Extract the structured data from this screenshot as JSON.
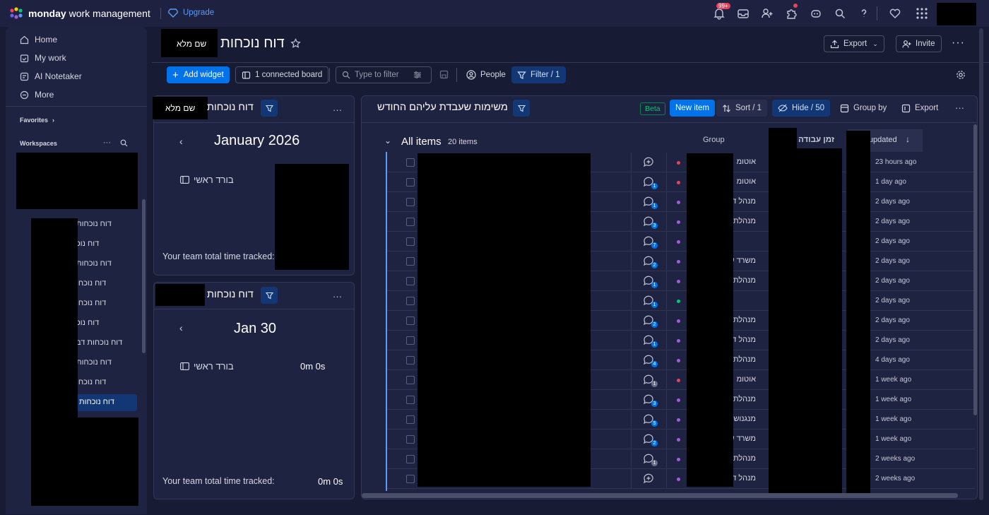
{
  "topbar": {
    "brand": "monday",
    "product": "work management",
    "upgrade": "Upgrade",
    "notif_count": "99+"
  },
  "sidebar": {
    "nav": [
      {
        "label": "Home",
        "icon": "home-icon"
      },
      {
        "label": "My work",
        "icon": "calendar-check-icon"
      },
      {
        "label": "AI Notetaker",
        "icon": "notetaker-icon"
      },
      {
        "label": "More",
        "icon": "more-circle-icon"
      }
    ],
    "favorites": "Favorites",
    "workspaces": "Workspaces",
    "boards": [
      "דוח נוכחות",
      "דוח נוכ",
      "דוח נוכחות",
      "דוח נוכחו",
      "דוח נוכחו",
      "דוח נוכ",
      "דוח נוכחות דב",
      "דוח נוכחות",
      "דוח נוכחו",
      "דוח נוכחות"
    ]
  },
  "dashboard": {
    "title": "דוח נוכחות",
    "name_placeholder": "שם מלא",
    "add_widget": "Add widget",
    "connected_board": "1 connected board",
    "filter_placeholder": "Type to filter",
    "people": "People",
    "filter": "Filter / 1",
    "export": "Export",
    "invite": "Invite"
  },
  "widget1": {
    "title": "דוח נוכחות",
    "name": "שם מלא",
    "period": "January 2026",
    "board": "בורד ראשי",
    "footer": "Your team total time tracked:"
  },
  "widget2": {
    "title": "דוח נוכחות",
    "period": "Jan 30",
    "board": "בורד ראשי",
    "board_value": "0m 0s",
    "footer": "Your team total time tracked:",
    "footer_value": "0m 0s"
  },
  "table_widget": {
    "title": "משימות שעבדת עליהם החודש",
    "beta": "Beta",
    "new_item": "New item",
    "sort": "Sort / 1",
    "hide": "Hide / 50",
    "group_by": "Group by",
    "export": "Export",
    "group_title": "All items",
    "group_count": "20 items",
    "col_group": "Group",
    "col_time": "זמן עבודה",
    "col_updated": "Last updated",
    "rows": [
      {
        "group": "אוטומ",
        "updated": "23 hours ago",
        "dot": "#e2445c",
        "updates": ""
      },
      {
        "group": "אוטומ",
        "updated": "1 day ago",
        "dot": "#e2445c",
        "updates": "1"
      },
      {
        "group": "מנהל ד",
        "updated": "2 days ago",
        "dot": "#a25ddc",
        "updates": "1"
      },
      {
        "group": "מנהלת",
        "updated": "2 days ago",
        "dot": "#a25ddc",
        "updates": "3"
      },
      {
        "group": "",
        "updated": "2 days ago",
        "dot": "#a25ddc",
        "updates": "7"
      },
      {
        "group": "משרד ש",
        "updated": "2 days ago",
        "dot": "#a25ddc",
        "updates": "2"
      },
      {
        "group": "מנהלת",
        "updated": "2 days ago",
        "dot": "#a25ddc",
        "updates": "1"
      },
      {
        "group": "",
        "updated": "2 days ago",
        "dot": "#00c875",
        "updates": "1"
      },
      {
        "group": "מנהלת",
        "updated": "2 days ago",
        "dot": "#a25ddc",
        "updates": "2"
      },
      {
        "group": "מנהל ד",
        "updated": "2 days ago",
        "dot": "#a25ddc",
        "updates": "1"
      },
      {
        "group": "מנהלת",
        "updated": "4 days ago",
        "dot": "#a25ddc",
        "updates": "4"
      },
      {
        "group": "אוטומ",
        "updated": "1 week ago",
        "dot": "#e2445c",
        "updates": "1"
      },
      {
        "group": "מנהלת",
        "updated": "1 week ago",
        "dot": "#a25ddc",
        "updates": "3"
      },
      {
        "group": "מנגנוש",
        "updated": "1 week ago",
        "dot": "#a25ddc",
        "updates": "5"
      },
      {
        "group": "משרד ש",
        "updated": "1 week ago",
        "dot": "#a25ddc",
        "updates": "2"
      },
      {
        "group": "מנהלת",
        "updated": "2 weeks ago",
        "dot": "#a25ddc",
        "updates": "1"
      },
      {
        "group": "מנהל ד",
        "updated": "2 weeks ago",
        "dot": "#a25ddc",
        "updates": ""
      }
    ]
  },
  "colors": {
    "accent": "#0073ea",
    "selected": "#133774",
    "panel": "#1f2342",
    "background": "#181b34"
  }
}
